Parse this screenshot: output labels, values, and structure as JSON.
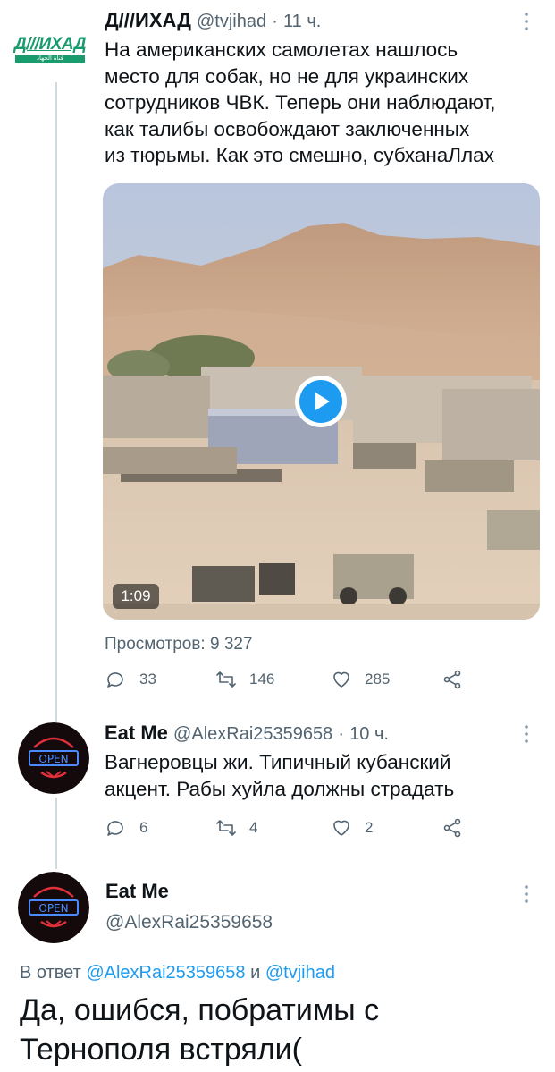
{
  "tweet1": {
    "author_name": "Д///ИХАД",
    "handle": "@tvjihad",
    "separator": "·",
    "time": "11 ч.",
    "avatar_logo": "Д///ИХАД",
    "avatar_sub": "‫ﻗﻨﺎﺓ ﺍﻟﺠﻬﺎﺩ‬",
    "text_lines": [
      "На американских самолетах нашлось",
      "место для собак, но не для украинских",
      "сотрудников ЧВК. Теперь они наблюдают,",
      "как талибы освобождают заключенных",
      "из тюрьмы. Как это смешно, субханаЛлах"
    ],
    "video_duration": "1:09",
    "views_label": "Просмотров: 9 327",
    "replies": "33",
    "retweets": "146",
    "likes": "285"
  },
  "tweet2": {
    "author_name": "Eat Me",
    "handle": "@AlexRai25359658",
    "separator": "·",
    "time": "10 ч.",
    "text_lines": [
      "Вагнеровцы жи. Типичный кубанский",
      "акцент. Рабы хуйла должны страдать"
    ],
    "replies": "6",
    "retweets": "4",
    "likes": "2"
  },
  "tweet3": {
    "author_name": "Eat Me",
    "handle": "@AlexRai25359658",
    "reply_prefix": "В ответ",
    "reply_mention1": "@AlexRai25359658",
    "reply_and": "и",
    "reply_mention2": "@tvjihad",
    "text_lines": [
      "Да, ошибся, побратимы с",
      "Тернополя встряли("
    ]
  },
  "avatar_sign": "OPEN",
  "icons": [
    "more-vertical-icon",
    "reply-icon",
    "retweet-icon",
    "like-icon",
    "share-icon",
    "play-icon"
  ],
  "colors": {
    "accent": "#1d9bf0",
    "muted": "#536471",
    "logo_green": "#1a9b6e",
    "neon_red": "#e0303a"
  }
}
